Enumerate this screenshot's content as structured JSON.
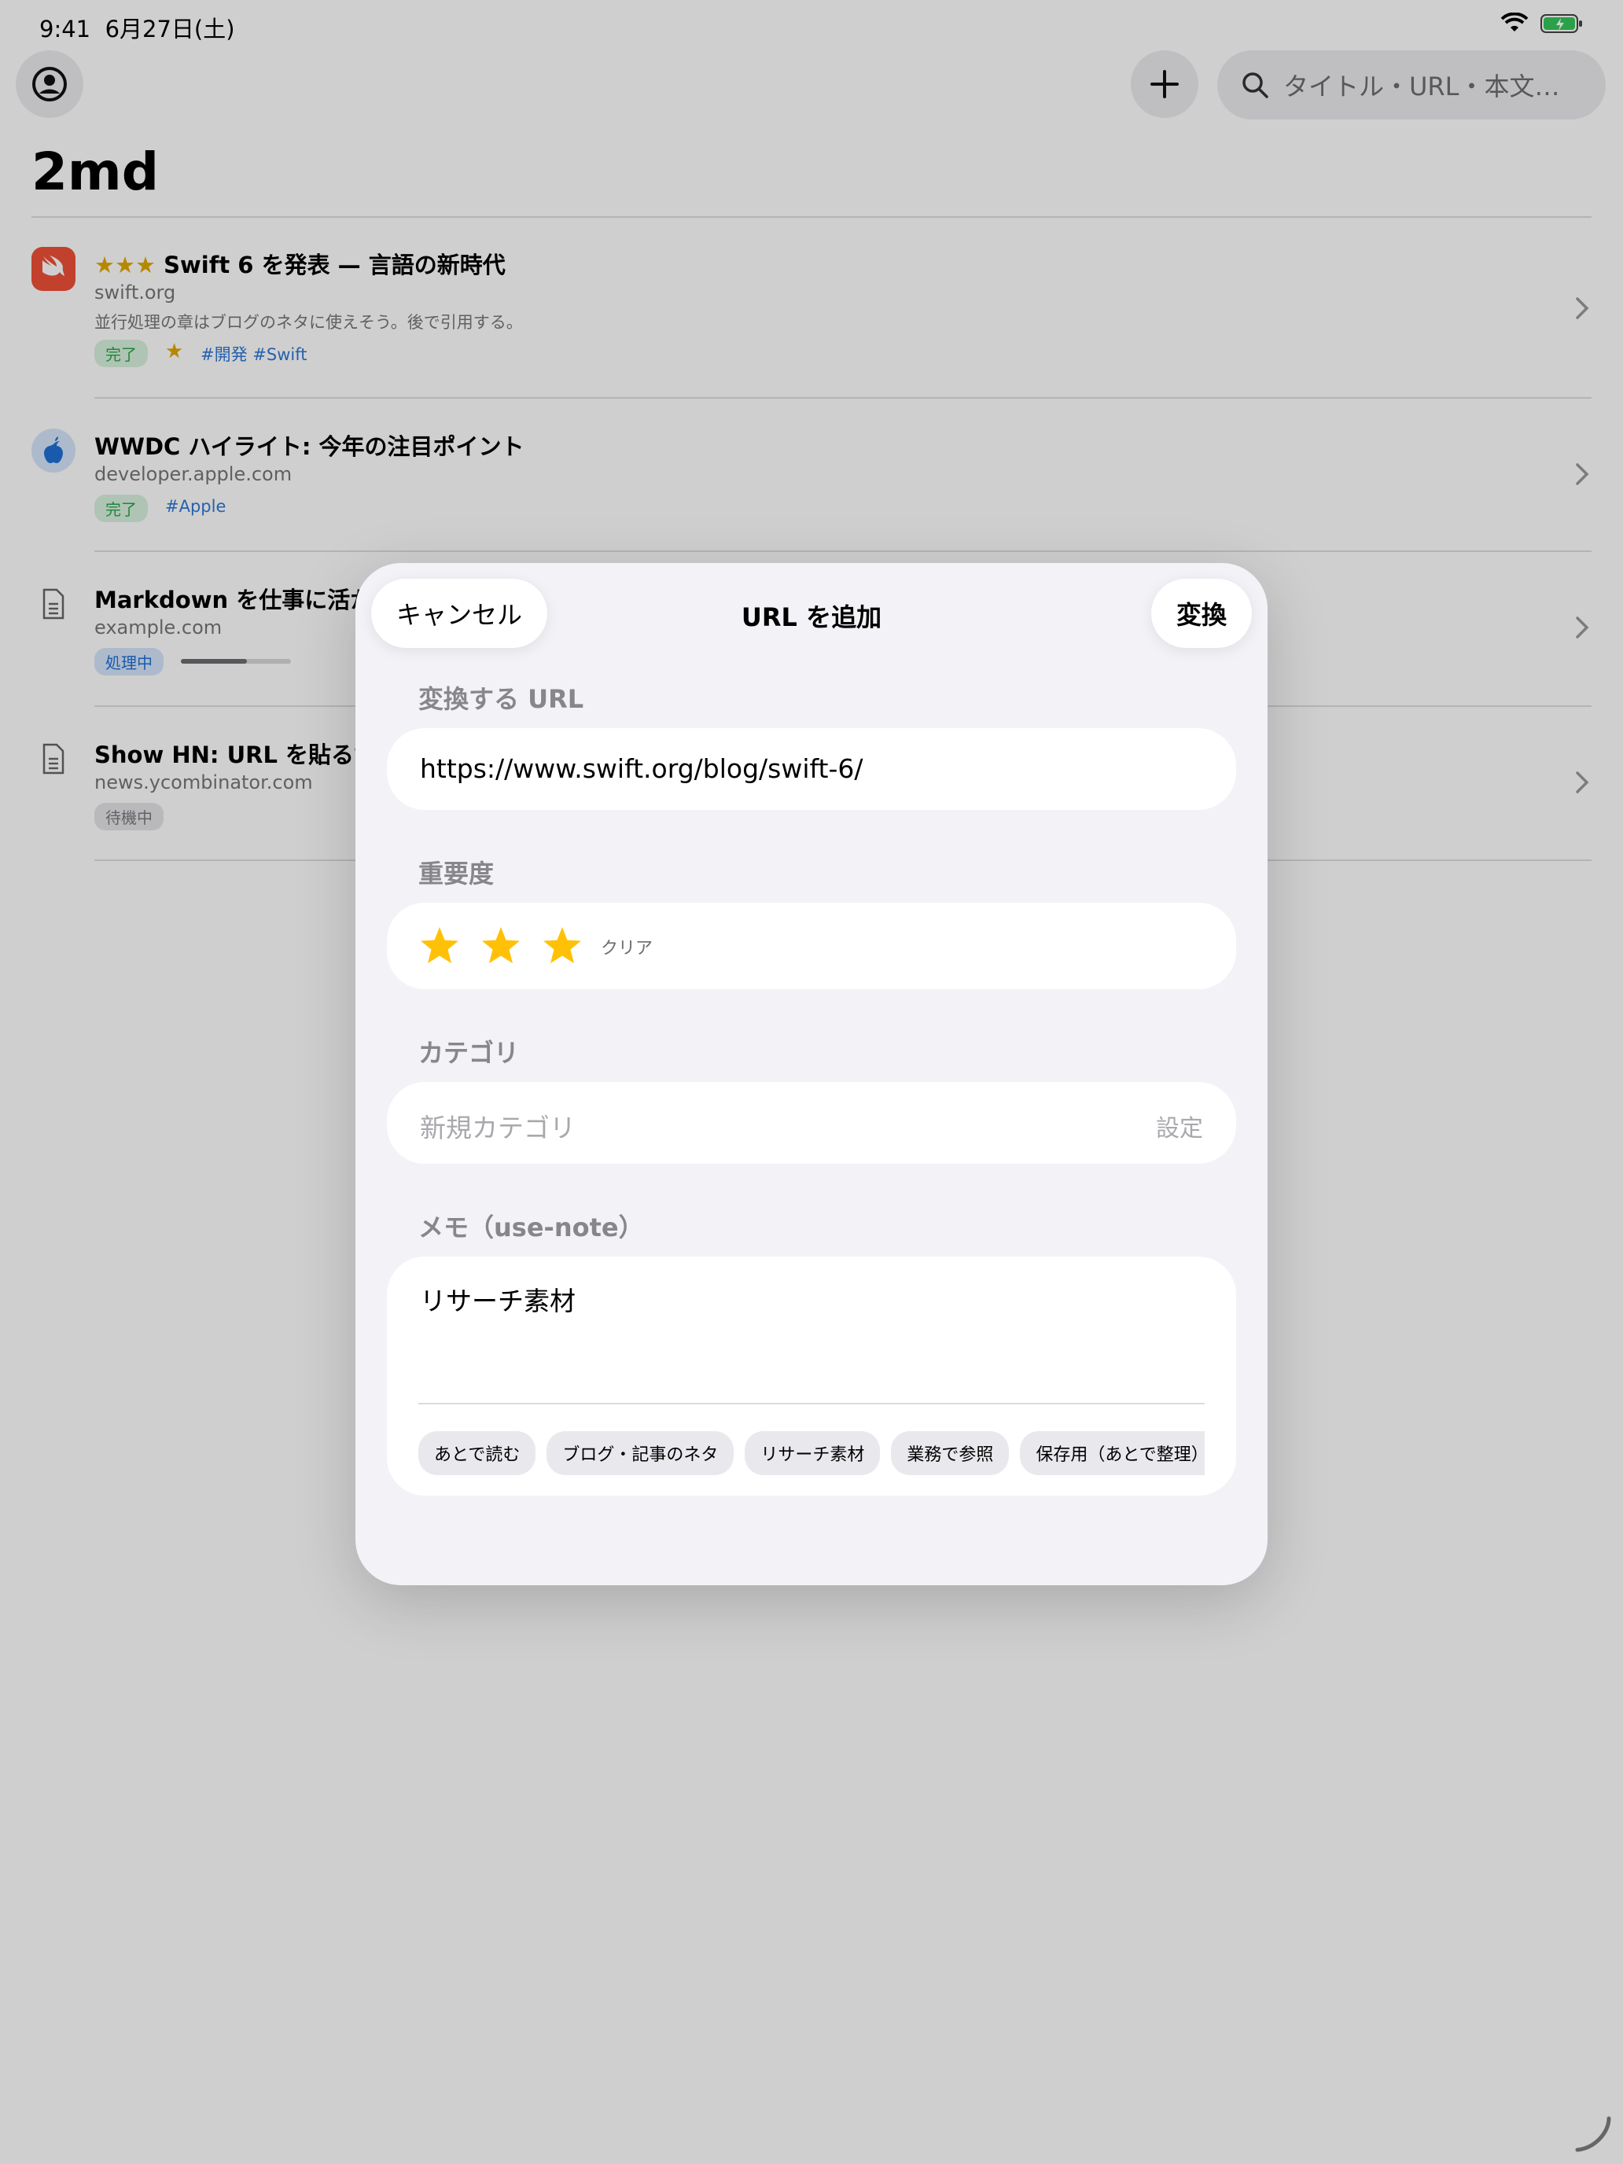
{
  "status_bar": {
    "time": "9:41",
    "date": "6月27日(土)"
  },
  "header": {
    "title": "2md",
    "search_placeholder": "タイトル・URL・本文…"
  },
  "articles": [
    {
      "stars": "★★★",
      "title": "Swift 6 を発表 — 言語の新時代",
      "domain": "swift.org",
      "note": "並行処理の章はブログのネタに使えそう。後で引用する。",
      "status": "完了",
      "importance": "★",
      "tags": "#開発 #Swift"
    },
    {
      "title": "WWDC ハイライト: 今年の注目ポイント",
      "domain": "developer.apple.com",
      "status": "完了",
      "tags": "#Apple"
    },
    {
      "title": "Markdown を仕事に活かす",
      "domain": "example.com",
      "status": "処理中",
      "progress": 0.6
    },
    {
      "title": "Show HN: URL を貼るだけ",
      "domain": "news.ycombinator.com",
      "status": "待機中"
    }
  ],
  "modal": {
    "title": "URL を追加",
    "cancel_label": "キャンセル",
    "convert_label": "変換",
    "url_label": "変換する URL",
    "url_value": "https://www.swift.org/blog/swift-6/",
    "importance_label": "重要度",
    "importance_value": 3,
    "clear_label": "クリア",
    "category_label": "カテゴリ",
    "category_placeholder": "新規カテゴリ",
    "category_set_label": "設定",
    "memo_label": "メモ（use-note）",
    "memo_value": "リサーチ素材",
    "memo_chips": [
      "あとで読む",
      "ブログ・記事のネタ",
      "リサーチ素材",
      "業務で参照",
      "保存用（あとで整理）"
    ]
  },
  "colors": {
    "accent": "#007aff",
    "star": "#ffc107",
    "done_bg": "#d8f2de",
    "done_fg": "#2aa44a",
    "processing_bg": "#d6e6fb",
    "processing_fg": "#1f6fd4",
    "waiting_bg": "#e4e4e8",
    "waiting_fg": "#7a7a7f"
  }
}
